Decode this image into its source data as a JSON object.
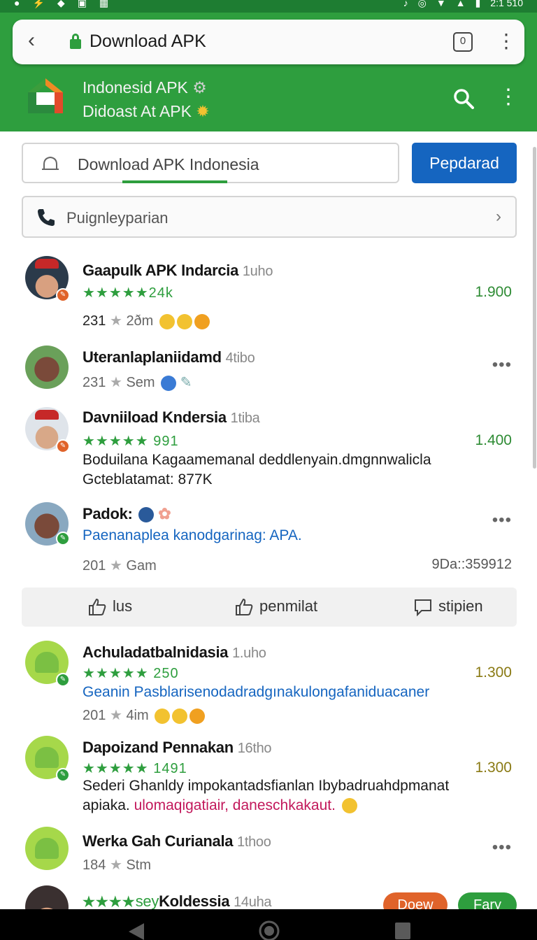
{
  "status_bar": {
    "time": "2:1 510"
  },
  "browser": {
    "page_title": "Download APK",
    "tab_count": "0"
  },
  "app_bar": {
    "title_line1": "Indonesid APK",
    "title_line2": "Didoast At APK"
  },
  "search": {
    "value": "Download APK Indonesia",
    "button_label": "Pepdarad"
  },
  "filter": {
    "label": "Puignleyparian"
  },
  "items": [
    {
      "name": "Gaapulk APK Indarcia",
      "time": "1uho",
      "rating": "★★★★★",
      "rating_text": "24k",
      "count": "231",
      "meta": "2ðm",
      "price": "1.900"
    },
    {
      "name": "Uteranlaplaniidamd",
      "time": "4tibo",
      "count": "231",
      "meta": "Sem"
    },
    {
      "name": "Davniiload Kndersia",
      "time": "1tiba",
      "rating": "★★★★★",
      "rating_text": "991",
      "price": "1.400",
      "desc1": "Boduilana Kagaamemanal deddlenyain.dmgnnwalicla",
      "desc2": "Gcteblatamat: 877K"
    },
    {
      "name": "Padok:",
      "desc1": "Paenanaplea kanodgarinag: APA.",
      "count": "201",
      "meta": "Gam",
      "extra": "9Da::359912"
    },
    {
      "name": "Achuladatbalnidasia",
      "time": "1.uho",
      "rating": "★★★★★",
      "rating_text": "250",
      "price": "1.300",
      "desc1": "Geanin Pasblarisenodadradgınakulongafaniduacaner",
      "count": "201",
      "meta": "4im"
    },
    {
      "name": "Dapoizand Pennakan",
      "time": "16tho",
      "rating": "★★★★★",
      "rating_text": "1491",
      "price": "1.300",
      "desc1": "Sederi Ghanldy impokantadsfianlan Ibybadruahdpmanat",
      "desc2_prefix": "apiaka.",
      "desc2_colored": "ulomaqigatiair, daneschkakaut."
    },
    {
      "name": "Werka Gah Curianala",
      "time": "1thoo",
      "count": "184",
      "meta": "Stm"
    },
    {
      "name": "Koldessia",
      "time": "14uha",
      "rating": "★★★★",
      "rating_text": "sey"
    }
  ],
  "actions": {
    "like": "lus",
    "share": "penmilat",
    "comment": "stipien"
  },
  "chips": {
    "orange": "Doew",
    "green": "Fary"
  },
  "colors": {
    "brand_green": "#2e9e3e",
    "primary_blue": "#1565c0",
    "chip_orange": "#e0632a"
  }
}
